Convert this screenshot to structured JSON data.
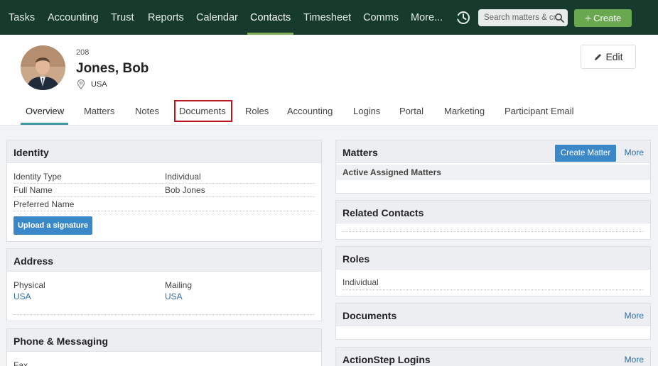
{
  "nav": {
    "items": [
      "Tasks",
      "Accounting",
      "Trust",
      "Reports",
      "Calendar",
      "Contacts",
      "Timesheet",
      "Comms",
      "More..."
    ],
    "active": "Contacts",
    "search_placeholder": "Search matters & co",
    "create_label": "Create",
    "accent_color": "#163a2b"
  },
  "contact": {
    "id": "208",
    "name": "Jones, Bob",
    "country": "USA",
    "edit_label": "Edit"
  },
  "tabs": [
    "Overview",
    "Matters",
    "Notes",
    "Documents",
    "Roles",
    "Accounting",
    "Logins",
    "Portal",
    "Marketing",
    "Participant Email"
  ],
  "identity": {
    "title": "Identity",
    "rows": [
      {
        "label": "Identity Type",
        "value": "Individual"
      },
      {
        "label": "Full Name",
        "value": "Bob Jones"
      },
      {
        "label": "Preferred Name",
        "value": ""
      }
    ],
    "upload_label": "Upload a signature"
  },
  "address": {
    "title": "Address",
    "physical_label": "Physical",
    "physical_value": "USA",
    "mailing_label": "Mailing",
    "mailing_value": "USA"
  },
  "phone": {
    "title": "Phone & Messaging",
    "fax_label": "Fax"
  },
  "matters": {
    "title": "Matters",
    "create_label": "Create Matter",
    "more_label": "More",
    "subhead": "Active Assigned Matters"
  },
  "related": {
    "title": "Related Contacts"
  },
  "roles": {
    "title": "Roles",
    "value": "Individual"
  },
  "documents": {
    "title": "Documents",
    "more_label": "More"
  },
  "logins": {
    "title": "ActionStep Logins",
    "more_label": "More"
  }
}
